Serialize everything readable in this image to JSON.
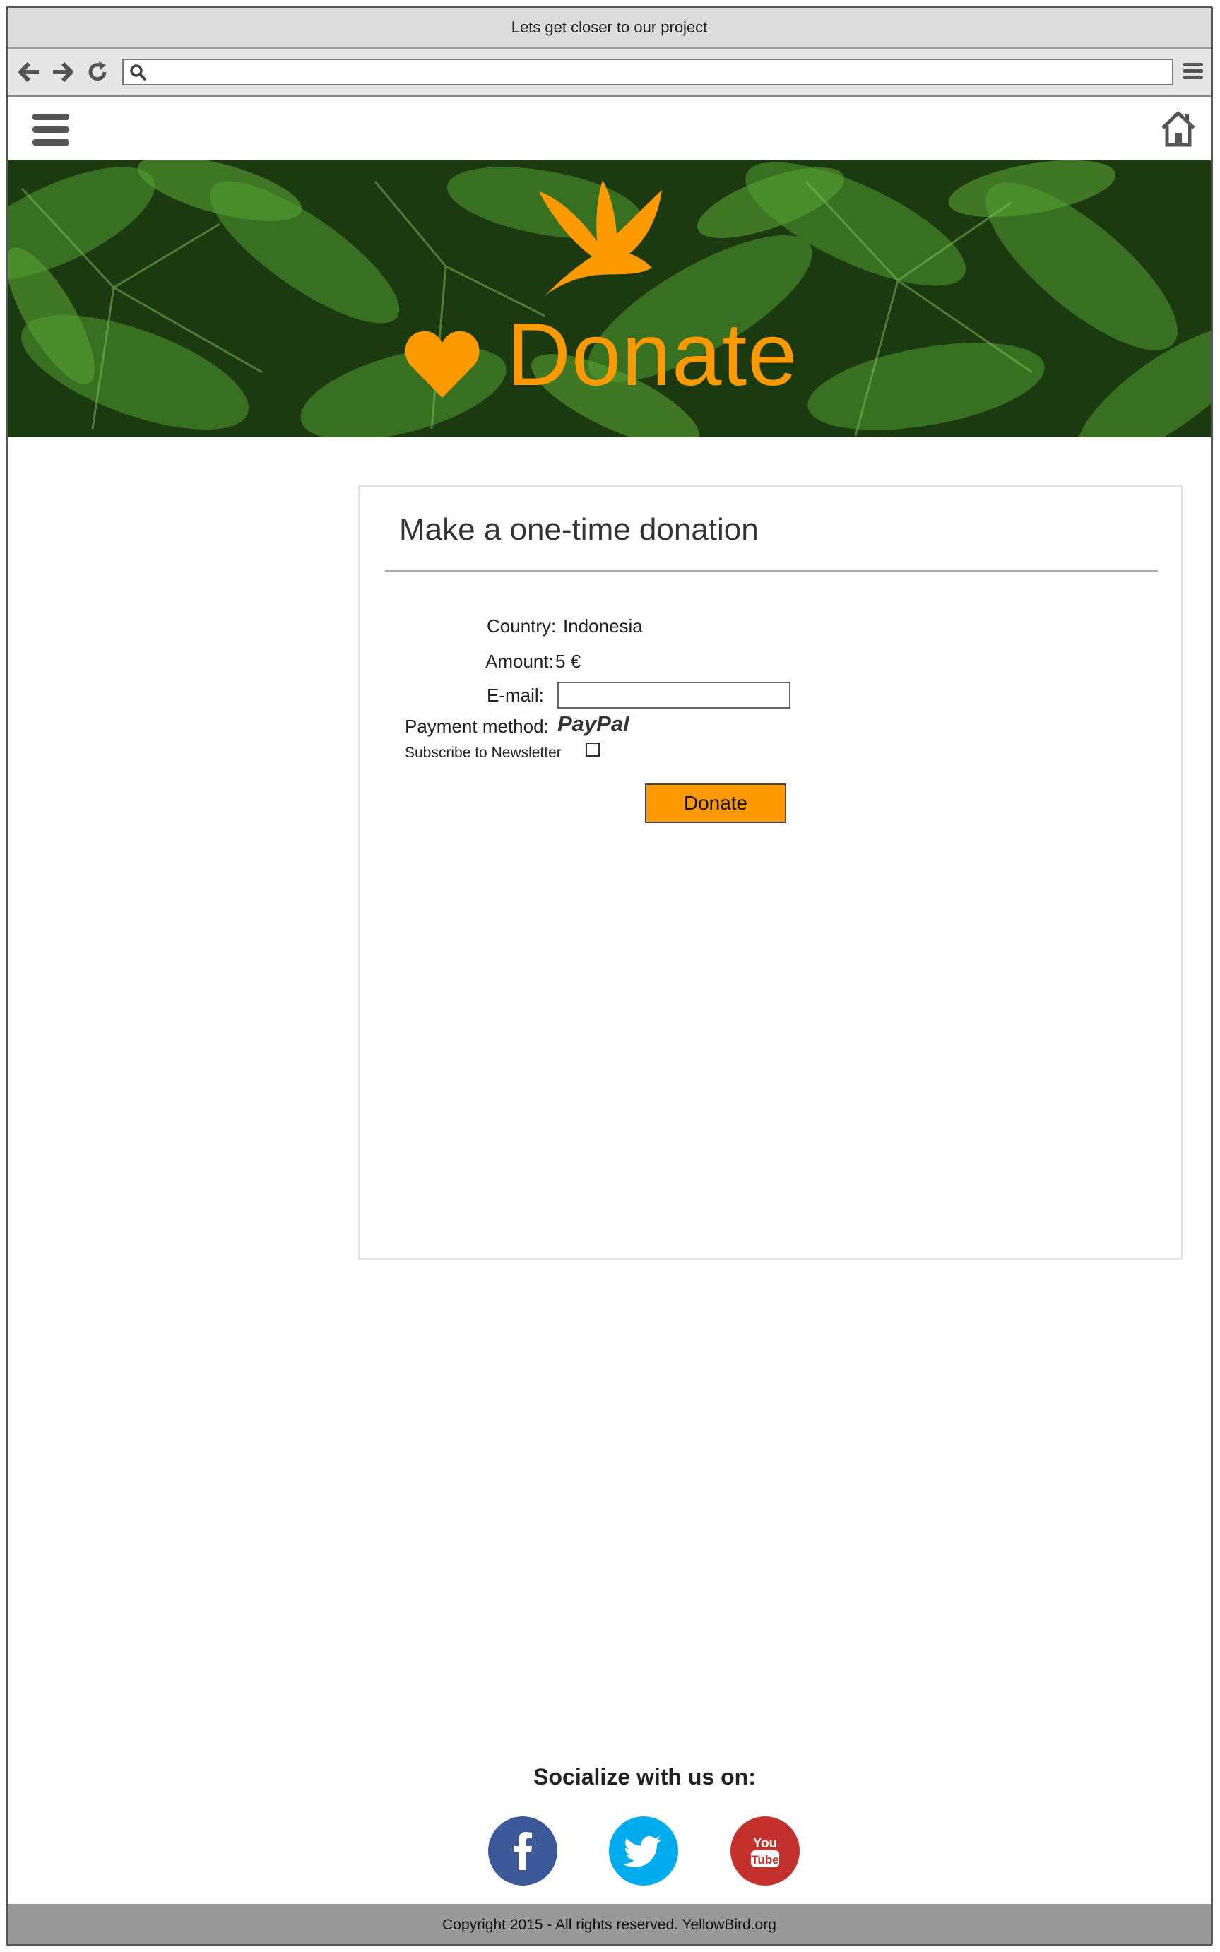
{
  "window": {
    "title": "Lets get closer to our project"
  },
  "browser": {
    "back_icon": "arrow-left-icon",
    "forward_icon": "arrow-right-icon",
    "reload_icon": "reload-icon",
    "search_icon": "search-icon",
    "menu_icon": "hamburger-icon",
    "url": ""
  },
  "appbar": {
    "menu_icon": "hamburger-icon",
    "home_icon": "home-icon"
  },
  "hero": {
    "title": "Donate",
    "accent_color": "#ff9900",
    "bird_icon": "bird-icon",
    "heart_icon": "heart-icon"
  },
  "donation_form": {
    "heading": "Make a one-time donation",
    "country_label": "Country:",
    "country_value": "Indonesia",
    "amount_label": "Amount:",
    "amount_value": "5 €",
    "email_label": "E-mail:",
    "email_value": "",
    "payment_label": "Payment method:",
    "payment_value": "PayPal",
    "subscribe_label": "Subscribe to Newsletter",
    "subscribe_checked": false,
    "submit_label": "Donate"
  },
  "social": {
    "heading": "Socialize with us on:",
    "links": [
      {
        "name": "facebook",
        "icon": "facebook-icon",
        "color": "#3b5998"
      },
      {
        "name": "twitter",
        "icon": "twitter-icon",
        "color": "#00aced"
      },
      {
        "name": "youtube",
        "icon": "youtube-icon",
        "color": "#c4302b",
        "logo_text_1": "You",
        "logo_text_2": "Tube"
      }
    ]
  },
  "footer": {
    "text": "Copyright 2015  - All rights reserved. YellowBird.org"
  }
}
